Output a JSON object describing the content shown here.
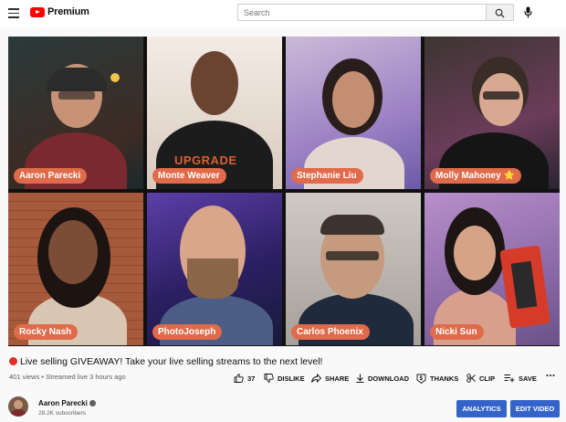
{
  "app": {
    "logo_text": "Premium"
  },
  "search": {
    "placeholder": "Search"
  },
  "video": {
    "participants": [
      {
        "name": "Aaron Parecki"
      },
      {
        "name": "Monte Weaver"
      },
      {
        "name": "Stephanie Liu"
      },
      {
        "name": "Molly Mahoney ⭐"
      },
      {
        "name": "Rocky Nash"
      },
      {
        "name": "PhotoJoseph"
      },
      {
        "name": "Carlos Phoenix"
      },
      {
        "name": "Nicki Sun"
      }
    ],
    "shirt_text": "UPGRADE"
  },
  "info": {
    "title": "Live selling GIVEAWAY! Take your live selling streams to the next level!",
    "meta": "401 views • Streamed live 3 hours ago"
  },
  "actions": {
    "likes": "37",
    "dislike": "DISLIKE",
    "share": "SHARE",
    "download": "DOWNLOAD",
    "thanks": "THANKS",
    "clip": "CLIP",
    "save": "SAVE"
  },
  "channel": {
    "name": "Aaron Parecki",
    "subscribers": "28.2K subscribers",
    "analytics": "ANALYTICS",
    "edit_video": "EDIT VIDEO"
  },
  "colors": {
    "brand_red": "#ff0000",
    "accent_blue": "#3464c9",
    "name_pill": "#e06a4a"
  }
}
